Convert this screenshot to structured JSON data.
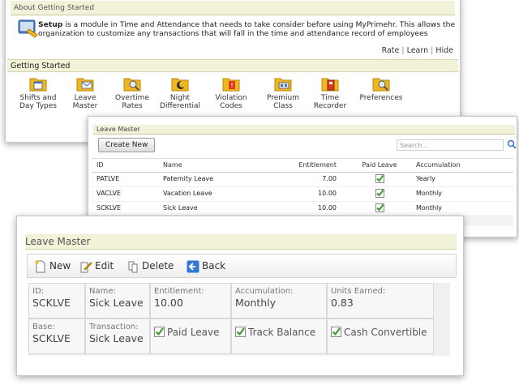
{
  "panel_getting_started": {
    "about_title": "About Getting Started",
    "setup_bold": "Setup",
    "setup_text": " is a module in Time and Attendance that needs to take consider before using MyPrimehr. This allows the organization to customize any transactions that will fall in the time and attendance record of employees",
    "links": [
      "Rate",
      "Learn",
      "Hide"
    ],
    "section_title": "Getting Started",
    "items": [
      {
        "label1": "Shifts and",
        "label2": "Day Types",
        "icon": "folder-calendar-icon"
      },
      {
        "label1": "Leave",
        "label2": "Master",
        "icon": "folder-mail-icon"
      },
      {
        "label1": "Overtime",
        "label2": "Rates",
        "icon": "folder-search-icon"
      },
      {
        "label1": "Night",
        "label2": "Differential",
        "icon": "folder-moon-icon"
      },
      {
        "label1": "Violation",
        "label2": "Codes",
        "icon": "folder-warning-icon"
      },
      {
        "label1": "Premium",
        "label2": "Class",
        "icon": "folder-gear-icon"
      },
      {
        "label1": "Time",
        "label2": "Recorder",
        "icon": "folder-clock-icon"
      },
      {
        "label1": "Preferences",
        "label2": "",
        "icon": "folder-preferences-icon"
      }
    ]
  },
  "panel_leave_list": {
    "title": "Leave Master",
    "create_label": "Create New",
    "search_placeholder": "Search...",
    "columns": [
      "ID",
      "Name",
      "Entitlement",
      "Paid Leave",
      "Accumulation"
    ],
    "rows": [
      {
        "id": "PATLVE",
        "name": "Paternity Leave",
        "entitlement": "7.00",
        "paid": true,
        "accumulation": "Yearly"
      },
      {
        "id": "VACLVE",
        "name": "Vacation Leave",
        "entitlement": "10.00",
        "paid": true,
        "accumulation": "Monthly"
      },
      {
        "id": "SCKLVE",
        "name": "Sick Leave",
        "entitlement": "10.00",
        "paid": true,
        "accumulation": "Monthly"
      }
    ]
  },
  "panel_leave_detail": {
    "title": "Leave Master",
    "toolbar": {
      "new": "New",
      "edit": "Edit",
      "delete": "Delete",
      "back": "Back"
    },
    "fields": {
      "id_label": "ID:",
      "id_value": "SCKLVE",
      "name_label": "Name:",
      "name_value": "Sick Leave",
      "entitlement_label": "Entitlement:",
      "entitlement_value": "10.00",
      "accumulation_label": "Accumulation:",
      "accumulation_value": "Monthly",
      "units_label": "Units Earned:",
      "units_value": "0.83",
      "base_label": "Base:",
      "base_value": "SCKLVE",
      "transaction_label": "Transaction:",
      "transaction_value": "Sick Leave",
      "paid_leave": "Paid Leave",
      "track_balance": "Track Balance",
      "cash_convertible": "Cash Convertible"
    }
  },
  "colors": {
    "accent_bar": "#f2f2d8",
    "check_green": "#3c9a2e",
    "folder_yellow": "#f0b820"
  }
}
